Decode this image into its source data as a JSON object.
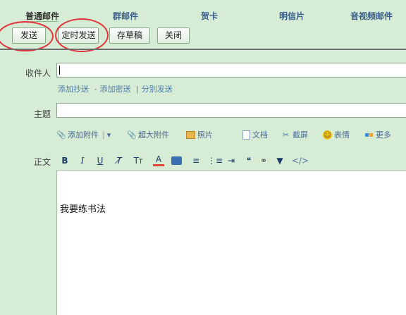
{
  "tabs": [
    {
      "label": "普通邮件"
    },
    {
      "label": "群邮件"
    },
    {
      "label": "贺卡"
    },
    {
      "label": "明信片"
    },
    {
      "label": "音视频邮件"
    }
  ],
  "toolbar": {
    "send_label": "发送",
    "scheduled_label": "定时发送",
    "draft_label": "存草稿",
    "close_label": "关闭"
  },
  "form": {
    "to_label": "收件人",
    "to_value": "",
    "cc_link": "添加抄送",
    "link_dash": "-",
    "bcc_link": "添加密送",
    "link_bar": "|",
    "separate_link": "分别发送",
    "subject_label": "主题",
    "subject_value": "",
    "body_label": "正文"
  },
  "attach": {
    "add_attachment": "添加附件",
    "super_attachment": "超大附件",
    "photo": "照片",
    "doc": "文档",
    "screenshot": "截屏",
    "emoji": "表情",
    "more": "更多"
  },
  "editor_toolbar": {
    "bold": "B",
    "italic": "I",
    "underline": "U",
    "quote": "❝",
    "code": "</>"
  },
  "editor": {
    "content": "我要练书法"
  },
  "colors": {
    "background": "#d6ecd4",
    "highlight_ring": "#e0323a",
    "link": "#4a7bb0"
  }
}
